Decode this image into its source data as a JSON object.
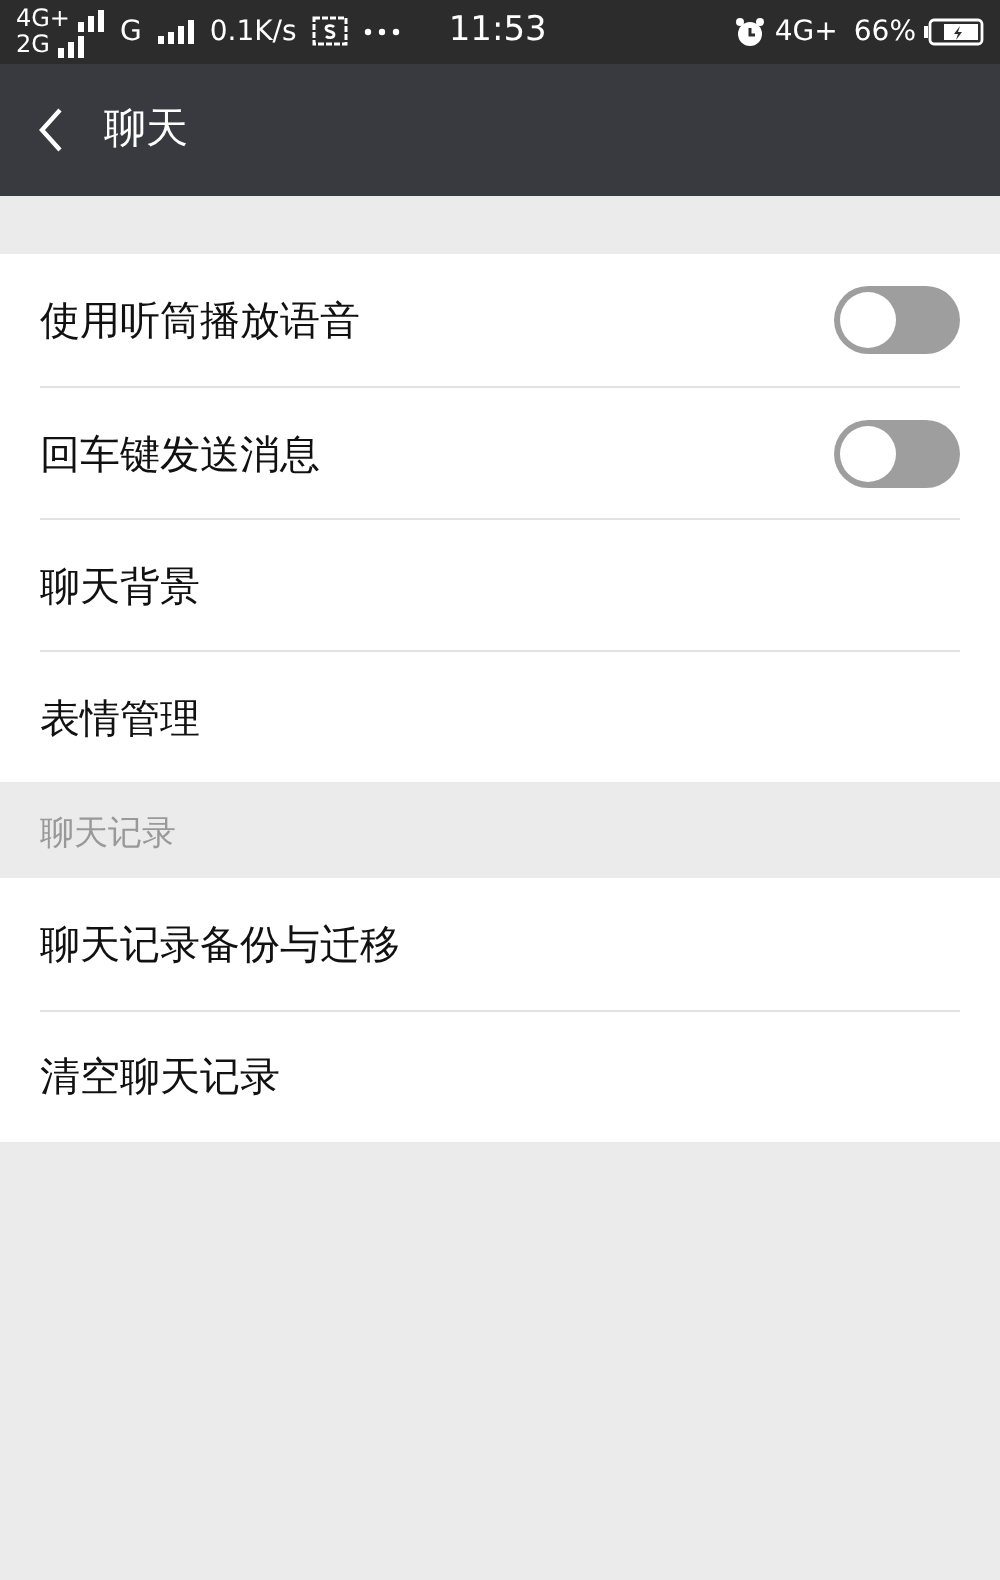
{
  "status_bar": {
    "sim1_network": "4G+",
    "sim2_network": "2G",
    "data_network": "G",
    "speed": "0.1K/s",
    "time": "11:53",
    "network_right": "4G+",
    "battery": "66%"
  },
  "header": {
    "title": "聊天"
  },
  "sections": [
    {
      "items": [
        {
          "label": "使用听筒播放语音",
          "kind": "toggle",
          "on": false
        },
        {
          "label": "回车键发送消息",
          "kind": "toggle",
          "on": false
        },
        {
          "label": "聊天背景",
          "kind": "link"
        },
        {
          "label": "表情管理",
          "kind": "link"
        }
      ]
    },
    {
      "title": "聊天记录",
      "items": [
        {
          "label": "聊天记录备份与迁移",
          "kind": "link"
        },
        {
          "label": "清空聊天记录",
          "kind": "link"
        }
      ]
    }
  ]
}
